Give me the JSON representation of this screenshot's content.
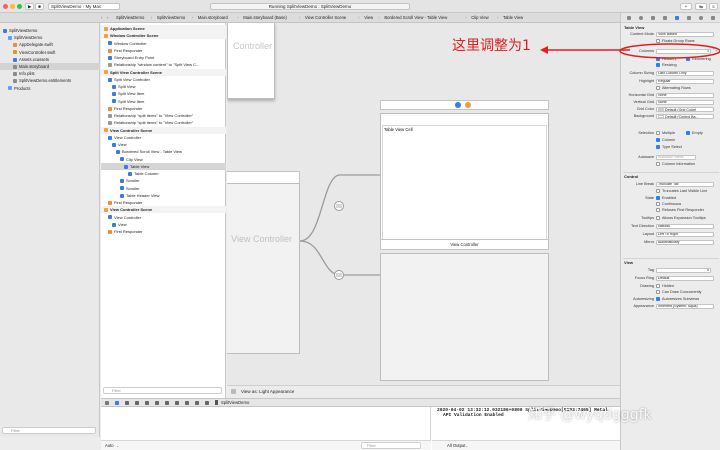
{
  "toolbar": {
    "scheme": "SplitViewDemo",
    "device": "My Mac",
    "status": "Running SplitViewDemo : SplitViewDemo"
  },
  "breadcrumbs": [
    "SplitViewDemo",
    "SplitViewDemo",
    "Main.storyboard",
    "Main.storyboard (Base)",
    "View Controller Scene",
    "View",
    "Bordered Scroll View - Table View",
    "Clip View",
    "Table View"
  ],
  "navigator": {
    "items": [
      {
        "label": "SplitViewDemo",
        "indent": 0
      },
      {
        "label": "SplitViewDemo",
        "indent": 1
      },
      {
        "label": "AppDelegate.swift",
        "indent": 2
      },
      {
        "label": "ViewController.swift",
        "indent": 2
      },
      {
        "label": "Assets.xcassets",
        "indent": 2
      },
      {
        "label": "Main.storyboard",
        "indent": 2
      },
      {
        "label": "Info.plist",
        "indent": 2
      },
      {
        "label": "SplitViewDemo.entitlements",
        "indent": 2
      },
      {
        "label": "Products",
        "indent": 1
      }
    ],
    "filter_placeholder": "Filter"
  },
  "outline": {
    "rows": [
      {
        "label": "Application Scene",
        "indent": 0,
        "head": true
      },
      {
        "label": "Window Controller Scene",
        "indent": 0,
        "head": true
      },
      {
        "label": "Window Controller",
        "indent": 1
      },
      {
        "label": "First Responder",
        "indent": 1
      },
      {
        "label": "Storyboard Entry Point",
        "indent": 1
      },
      {
        "label": "Relationship \"window content\" to \"Split View C...",
        "indent": 1
      },
      {
        "label": "Split View Controller Scene",
        "indent": 0,
        "head": true
      },
      {
        "label": "Split View Controller",
        "indent": 1
      },
      {
        "label": "Split View",
        "indent": 2
      },
      {
        "label": "Split View Item",
        "indent": 2
      },
      {
        "label": "Split View Item",
        "indent": 2
      },
      {
        "label": "First Responder",
        "indent": 1
      },
      {
        "label": "Relationship \"split items\" to \"View Controller\"",
        "indent": 1
      },
      {
        "label": "Relationship \"split items\" to \"View Controller\"",
        "indent": 1
      },
      {
        "label": "View Controller Scene",
        "indent": 0,
        "head": true
      },
      {
        "label": "View Controller",
        "indent": 1
      },
      {
        "label": "View",
        "indent": 2
      },
      {
        "label": "Bordered Scroll View - Table View",
        "indent": 3
      },
      {
        "label": "Clip View",
        "indent": 4
      },
      {
        "label": "Table View",
        "indent": 5,
        "selected": true
      },
      {
        "label": "Table Column",
        "indent": 6
      },
      {
        "label": "Scroller",
        "indent": 4
      },
      {
        "label": "Scroller",
        "indent": 4
      },
      {
        "label": "Table Header View",
        "indent": 4
      },
      {
        "label": "First Responder",
        "indent": 1
      },
      {
        "label": "View Controller Scene",
        "indent": 0,
        "head": true
      },
      {
        "label": "View Controller",
        "indent": 1
      },
      {
        "label": "View",
        "indent": 2
      },
      {
        "label": "First Responder",
        "indent": 1
      }
    ],
    "filter_placeholder": "Filter"
  },
  "canvas": {
    "controller_label_top": "Controller",
    "controller_label_mid": "View Controller",
    "table_cell_label": "Table View Cell",
    "vc_bar_title": "View Controller",
    "appearance": "View as: Light Appearance",
    "zoom": "75%"
  },
  "debug": {
    "target": "SplitViewDemo",
    "console_line1": "2020-04-02 13:32:12.932186+0800 SplitViewDemo[5193:7465] Metal",
    "console_line2": "API Validation Enabled",
    "auto_label": "Auto",
    "all_output": "All Output",
    "filter_placeholder": "Filter"
  },
  "annotation": {
    "text": "这里调整为1",
    "color": "#e02020"
  },
  "watermark": "知乎 @wyqdgggfk",
  "inspector": {
    "table_view_header": "Table View",
    "content_mode": {
      "label": "Content Mode",
      "value": "View Based"
    },
    "floats_group_rows": "Floats Group Rows",
    "columns": {
      "label": "Columns",
      "value": "1"
    },
    "headers": "Headers",
    "reordering": "Reordering",
    "resizing": "Resizing",
    "column_sizing": {
      "label": "Column Sizing",
      "value": "Last Column Only"
    },
    "highlight": {
      "label": "Highlight",
      "value": "Regular"
    },
    "alternating_rows": "Alternating Rows",
    "horizontal_grid": {
      "label": "Horizontal Grid",
      "value": "None"
    },
    "vertical_grid": {
      "label": "Vertical Grid",
      "value": "None"
    },
    "grid_color": {
      "label": "Grid Color",
      "value": "Default (Grid Color)"
    },
    "background": {
      "label": "Background",
      "value": "Default (Control Ba..."
    },
    "selection_label": "Selection",
    "multiple": "Multiple",
    "empty": "Empty",
    "column": "Column",
    "type_select": "Type Select",
    "autosave": {
      "label": "Autosave",
      "placeholder": "Autosave Name"
    },
    "column_information": "Column Information",
    "control_header": "Control",
    "line_break": {
      "label": "Line Break",
      "value": "Truncate Tail"
    },
    "truncates_last": "Truncates Last Visible Line",
    "state_label": "State",
    "enabled": "Enabled",
    "continuous": "Continuous",
    "refuses_first_responder": "Refuses First Responder",
    "tooltips_label": "Tooltips",
    "allows_expansion": "Allows Expansion Tooltips",
    "text_direction": {
      "label": "Text Direction",
      "value": "Natural"
    },
    "layout": {
      "label": "Layout",
      "value": "Left To Right"
    },
    "mirror": {
      "label": "Mirror",
      "value": "Automatically"
    },
    "view_header": "View",
    "tag": {
      "label": "Tag",
      "value": "0"
    },
    "focus_ring": {
      "label": "Focus Ring",
      "value": "Default"
    },
    "drawing_label": "Drawing",
    "hidden": "Hidden",
    "can_draw_concurrently": "Can Draw Concurrently",
    "autoresizing_label": "Autoresizing",
    "autoresizes_subviews": "Autoresizes Subviews",
    "appearance": {
      "label": "Appearance",
      "value": "Inherited (System, Aqua)"
    }
  }
}
